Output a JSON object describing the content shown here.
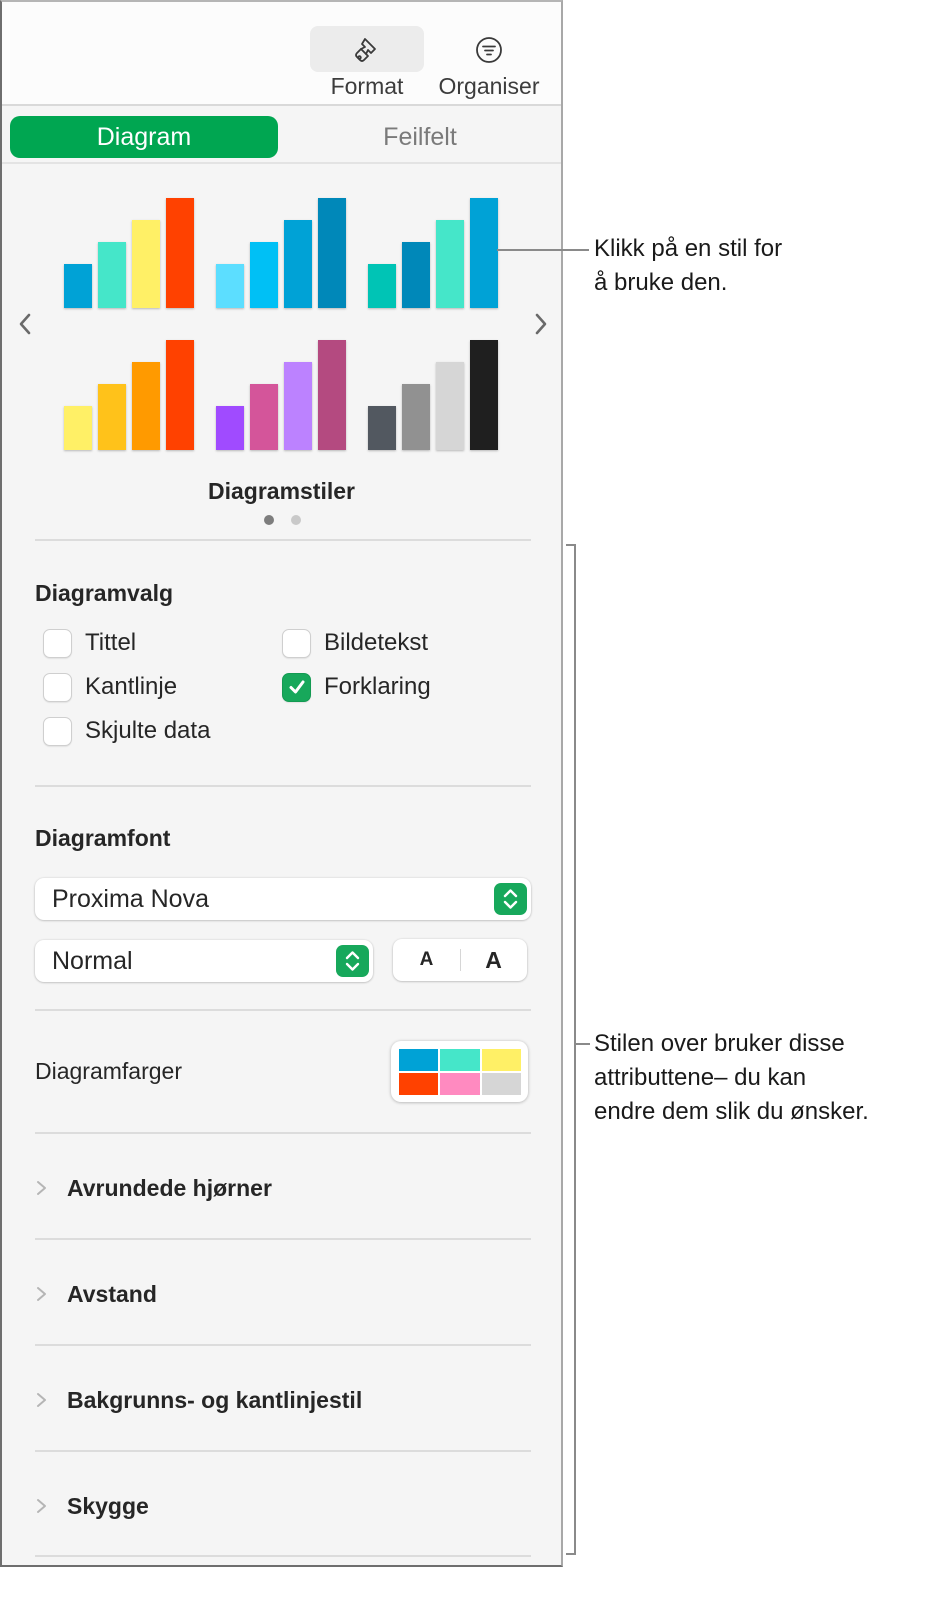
{
  "toolbar": {
    "format_label": "Format",
    "organise_label": "Organiser"
  },
  "tabs": [
    {
      "label": "Diagram",
      "active": true
    },
    {
      "label": "Feilfelt",
      "active": false
    }
  ],
  "chart_styles": {
    "caption": "Diagramstiler",
    "page": 1,
    "page_count": 2,
    "swatches": [
      {
        "colors": [
          "#00a2d6",
          "#45e6c9",
          "#fff066",
          "#ff4100"
        ]
      },
      {
        "colors": [
          "#5cdeff",
          "#00c0f5",
          "#00a2d6",
          "#0088b9"
        ]
      },
      {
        "colors": [
          "#00c4b5",
          "#0088b9",
          "#45e6c9",
          "#00a2d6"
        ]
      },
      {
        "colors": [
          "#fff066",
          "#ffc21a",
          "#ff9a00",
          "#ff4100"
        ]
      },
      {
        "colors": [
          "#a04bff",
          "#d4559a",
          "#bc82ff",
          "#b44a80"
        ]
      },
      {
        "colors": [
          "#525860",
          "#919191",
          "#d6d6d6",
          "#1f1f1f"
        ]
      }
    ],
    "bar_values": [
      1,
      1.5,
      2,
      2.5
    ]
  },
  "chart_options": {
    "title": "Diagramvalg",
    "checkboxes": [
      {
        "label": "Tittel",
        "checked": false
      },
      {
        "label": "Bildetekst",
        "checked": false
      },
      {
        "label": "Kantlinje",
        "checked": false
      },
      {
        "label": "Forklaring",
        "checked": true
      },
      {
        "label": "Skjulte data",
        "checked": false
      }
    ]
  },
  "chart_font": {
    "title": "Diagramfont",
    "font_family": "Proxima Nova",
    "font_style": "Normal",
    "decrease_label": "A",
    "increase_label": "A"
  },
  "chart_colors": {
    "label": "Diagramfarger",
    "colors": [
      "#00a2d6",
      "#45e6c9",
      "#fff066",
      "#ff4100",
      "#ff8ac0",
      "#d6d6d6"
    ]
  },
  "disclosures": [
    {
      "label": "Avrundede hjørner"
    },
    {
      "label": "Avstand"
    },
    {
      "label": "Bakgrunns- og kantlinjestil"
    },
    {
      "label": "Skygge"
    }
  ],
  "callouts": {
    "styles": [
      "Klikk på en stil for",
      "å bruke den."
    ],
    "attributes": [
      "Stilen over bruker disse",
      "attributtene– du kan",
      "endre dem slik du ønsker."
    ]
  },
  "accent_color": "#00a651"
}
